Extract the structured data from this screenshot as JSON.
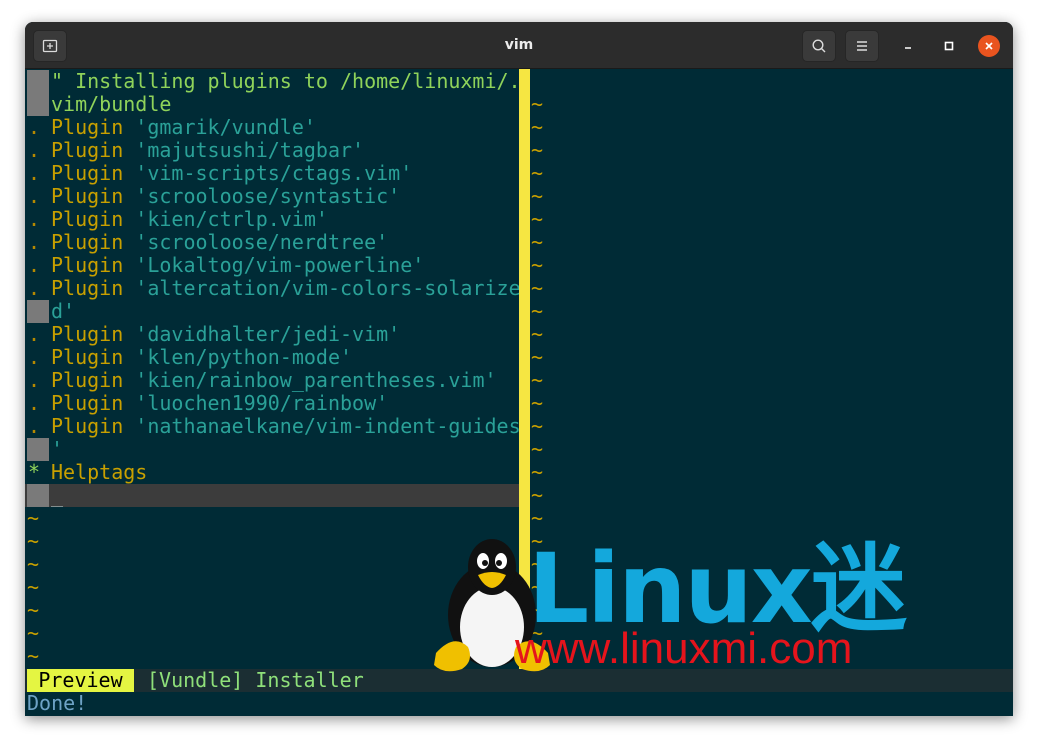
{
  "window": {
    "title": "vim"
  },
  "editor": {
    "lines": [
      {
        "gutter": "",
        "sign": true,
        "parts": [
          {
            "cls": "cmt",
            "text": "\" Installing plugins to /home/linuxmi/."
          }
        ]
      },
      {
        "gutter": "",
        "sign": true,
        "parts": [
          {
            "cls": "cmt",
            "text": "vim/bundle"
          }
        ]
      },
      {
        "gutter": ".",
        "parts": [
          {
            "cls": "kw",
            "text": "Plugin "
          },
          {
            "cls": "str",
            "text": "'gmarik/vundle'"
          }
        ]
      },
      {
        "gutter": ".",
        "parts": [
          {
            "cls": "kw",
            "text": "Plugin "
          },
          {
            "cls": "str",
            "text": "'majutsushi/tagbar'"
          }
        ]
      },
      {
        "gutter": ".",
        "parts": [
          {
            "cls": "kw",
            "text": "Plugin "
          },
          {
            "cls": "str",
            "text": "'vim-scripts/ctags.vim'"
          }
        ]
      },
      {
        "gutter": ".",
        "parts": [
          {
            "cls": "kw",
            "text": "Plugin "
          },
          {
            "cls": "str",
            "text": "'scrooloose/syntastic'"
          }
        ]
      },
      {
        "gutter": ".",
        "parts": [
          {
            "cls": "kw",
            "text": "Plugin "
          },
          {
            "cls": "str",
            "text": "'kien/ctrlp.vim'"
          }
        ]
      },
      {
        "gutter": ".",
        "parts": [
          {
            "cls": "kw",
            "text": "Plugin "
          },
          {
            "cls": "str",
            "text": "'scrooloose/nerdtree'"
          }
        ]
      },
      {
        "gutter": ".",
        "parts": [
          {
            "cls": "kw",
            "text": "Plugin "
          },
          {
            "cls": "str",
            "text": "'Lokaltog/vim-powerline'"
          }
        ]
      },
      {
        "gutter": ".",
        "parts": [
          {
            "cls": "kw",
            "text": "Plugin "
          },
          {
            "cls": "str",
            "text": "'altercation/vim-colors-solarize"
          }
        ]
      },
      {
        "gutter": "",
        "sign": true,
        "parts": [
          {
            "cls": "str",
            "text": "d'"
          }
        ]
      },
      {
        "gutter": ".",
        "parts": [
          {
            "cls": "kw",
            "text": "Plugin "
          },
          {
            "cls": "str",
            "text": "'davidhalter/jedi-vim'"
          }
        ]
      },
      {
        "gutter": ".",
        "parts": [
          {
            "cls": "kw",
            "text": "Plugin "
          },
          {
            "cls": "str",
            "text": "'klen/python-mode'"
          }
        ]
      },
      {
        "gutter": ".",
        "parts": [
          {
            "cls": "kw",
            "text": "Plugin "
          },
          {
            "cls": "str",
            "text": "'kien/rainbow_parentheses.vim'"
          }
        ]
      },
      {
        "gutter": ".",
        "parts": [
          {
            "cls": "kw",
            "text": "Plugin "
          },
          {
            "cls": "str",
            "text": "'luochen1990/rainbow'"
          }
        ]
      },
      {
        "gutter": ".",
        "parts": [
          {
            "cls": "kw",
            "text": "Plugin "
          },
          {
            "cls": "str",
            "text": "'nathanaelkane/vim-indent-guides"
          }
        ]
      },
      {
        "gutter": "",
        "sign": true,
        "parts": [
          {
            "cls": "str",
            "text": "'"
          }
        ]
      },
      {
        "gutter": "*",
        "star": true,
        "parts": [
          {
            "cls": "kw",
            "text": "Helptags"
          }
        ]
      },
      {
        "gutter": "",
        "sign": true,
        "cursorline": true,
        "parts": [
          {
            "cls": "cursor-char",
            "text": "_"
          }
        ]
      }
    ],
    "left_tildes": 7,
    "right_tildes": 25,
    "tilde": "~"
  },
  "statusline": {
    "mode": "Preview",
    "file": "[Vundle] Installer"
  },
  "cmdline": {
    "message": "Done!"
  },
  "watermark": {
    "logo_text": "Linux迷",
    "url": "www.linuxmi.com"
  },
  "colors": {
    "background": "#002b36",
    "separator": "#f6e642",
    "keyword": "#c8a000",
    "string": "#2aa198",
    "comment": "#8fd35a",
    "close_button": "#e9541f",
    "logo_blue": "#14a8dc",
    "logo_red": "#e5141c"
  }
}
